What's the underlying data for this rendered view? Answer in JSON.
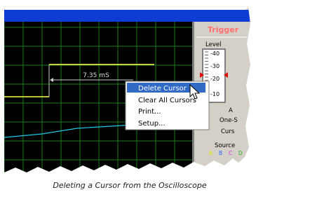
{
  "measurement": {
    "value": "7.35 mS"
  },
  "trigger": {
    "title": "Trigger",
    "level_label": "Level",
    "scale": [
      "-40",
      "-30",
      "-20",
      "-10"
    ],
    "side_labels": [
      "A",
      "One-S",
      "Curs"
    ],
    "source_label": "Source",
    "channels": [
      "A",
      "B",
      "C",
      "D"
    ]
  },
  "context_menu": {
    "items": [
      "Delete Cursor",
      "Clear All Cursors",
      "Print...",
      "Setup..."
    ],
    "highlighted_index": 0
  },
  "caption": "Deleting a Cursor from the Oscilloscope",
  "colors": {
    "scope_bg": "#000000",
    "grid": "#1f7a1f",
    "title_bar": "#0a3cd4",
    "trace_yellow": "#ffff44",
    "trace_cyan": "#22c8e8",
    "menu_highlight": "#316ac5",
    "panel": "#d4d0c8",
    "trigger_title": "#ff7070",
    "marker_red": "#e01010",
    "channel_colors": [
      "#e8e800",
      "#3060ff",
      "#e030e0",
      "#20b020"
    ]
  },
  "icons": [
    "mouse-pointer-icon",
    "level-marker-icon"
  ]
}
